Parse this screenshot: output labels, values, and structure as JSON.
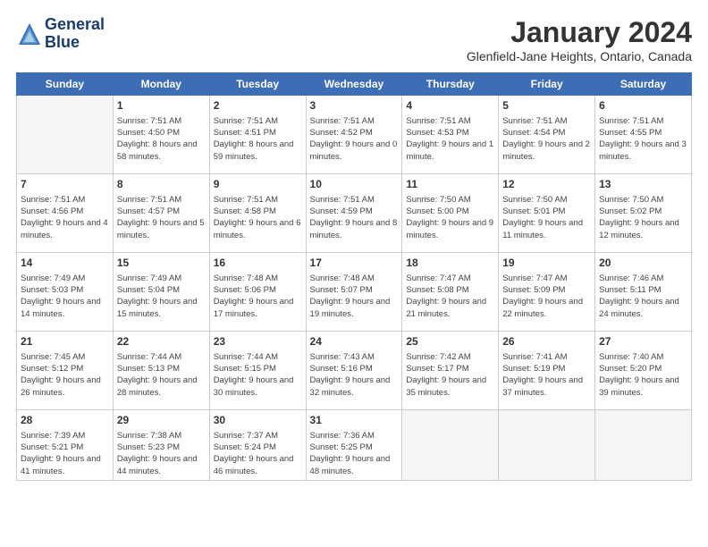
{
  "header": {
    "logo_line1": "General",
    "logo_line2": "Blue",
    "month": "January 2024",
    "location": "Glenfield-Jane Heights, Ontario, Canada"
  },
  "weekdays": [
    "Sunday",
    "Monday",
    "Tuesday",
    "Wednesday",
    "Thursday",
    "Friday",
    "Saturday"
  ],
  "weeks": [
    [
      {
        "day": "",
        "sunrise": "",
        "sunset": "",
        "daylight": ""
      },
      {
        "day": "1",
        "sunrise": "Sunrise: 7:51 AM",
        "sunset": "Sunset: 4:50 PM",
        "daylight": "Daylight: 8 hours and 58 minutes."
      },
      {
        "day": "2",
        "sunrise": "Sunrise: 7:51 AM",
        "sunset": "Sunset: 4:51 PM",
        "daylight": "Daylight: 8 hours and 59 minutes."
      },
      {
        "day": "3",
        "sunrise": "Sunrise: 7:51 AM",
        "sunset": "Sunset: 4:52 PM",
        "daylight": "Daylight: 9 hours and 0 minutes."
      },
      {
        "day": "4",
        "sunrise": "Sunrise: 7:51 AM",
        "sunset": "Sunset: 4:53 PM",
        "daylight": "Daylight: 9 hours and 1 minute."
      },
      {
        "day": "5",
        "sunrise": "Sunrise: 7:51 AM",
        "sunset": "Sunset: 4:54 PM",
        "daylight": "Daylight: 9 hours and 2 minutes."
      },
      {
        "day": "6",
        "sunrise": "Sunrise: 7:51 AM",
        "sunset": "Sunset: 4:55 PM",
        "daylight": "Daylight: 9 hours and 3 minutes."
      }
    ],
    [
      {
        "day": "7",
        "sunrise": "Sunrise: 7:51 AM",
        "sunset": "Sunset: 4:56 PM",
        "daylight": "Daylight: 9 hours and 4 minutes."
      },
      {
        "day": "8",
        "sunrise": "Sunrise: 7:51 AM",
        "sunset": "Sunset: 4:57 PM",
        "daylight": "Daylight: 9 hours and 5 minutes."
      },
      {
        "day": "9",
        "sunrise": "Sunrise: 7:51 AM",
        "sunset": "Sunset: 4:58 PM",
        "daylight": "Daylight: 9 hours and 6 minutes."
      },
      {
        "day": "10",
        "sunrise": "Sunrise: 7:51 AM",
        "sunset": "Sunset: 4:59 PM",
        "daylight": "Daylight: 9 hours and 8 minutes."
      },
      {
        "day": "11",
        "sunrise": "Sunrise: 7:50 AM",
        "sunset": "Sunset: 5:00 PM",
        "daylight": "Daylight: 9 hours and 9 minutes."
      },
      {
        "day": "12",
        "sunrise": "Sunrise: 7:50 AM",
        "sunset": "Sunset: 5:01 PM",
        "daylight": "Daylight: 9 hours and 11 minutes."
      },
      {
        "day": "13",
        "sunrise": "Sunrise: 7:50 AM",
        "sunset": "Sunset: 5:02 PM",
        "daylight": "Daylight: 9 hours and 12 minutes."
      }
    ],
    [
      {
        "day": "14",
        "sunrise": "Sunrise: 7:49 AM",
        "sunset": "Sunset: 5:03 PM",
        "daylight": "Daylight: 9 hours and 14 minutes."
      },
      {
        "day": "15",
        "sunrise": "Sunrise: 7:49 AM",
        "sunset": "Sunset: 5:04 PM",
        "daylight": "Daylight: 9 hours and 15 minutes."
      },
      {
        "day": "16",
        "sunrise": "Sunrise: 7:48 AM",
        "sunset": "Sunset: 5:06 PM",
        "daylight": "Daylight: 9 hours and 17 minutes."
      },
      {
        "day": "17",
        "sunrise": "Sunrise: 7:48 AM",
        "sunset": "Sunset: 5:07 PM",
        "daylight": "Daylight: 9 hours and 19 minutes."
      },
      {
        "day": "18",
        "sunrise": "Sunrise: 7:47 AM",
        "sunset": "Sunset: 5:08 PM",
        "daylight": "Daylight: 9 hours and 21 minutes."
      },
      {
        "day": "19",
        "sunrise": "Sunrise: 7:47 AM",
        "sunset": "Sunset: 5:09 PM",
        "daylight": "Daylight: 9 hours and 22 minutes."
      },
      {
        "day": "20",
        "sunrise": "Sunrise: 7:46 AM",
        "sunset": "Sunset: 5:11 PM",
        "daylight": "Daylight: 9 hours and 24 minutes."
      }
    ],
    [
      {
        "day": "21",
        "sunrise": "Sunrise: 7:45 AM",
        "sunset": "Sunset: 5:12 PM",
        "daylight": "Daylight: 9 hours and 26 minutes."
      },
      {
        "day": "22",
        "sunrise": "Sunrise: 7:44 AM",
        "sunset": "Sunset: 5:13 PM",
        "daylight": "Daylight: 9 hours and 28 minutes."
      },
      {
        "day": "23",
        "sunrise": "Sunrise: 7:44 AM",
        "sunset": "Sunset: 5:15 PM",
        "daylight": "Daylight: 9 hours and 30 minutes."
      },
      {
        "day": "24",
        "sunrise": "Sunrise: 7:43 AM",
        "sunset": "Sunset: 5:16 PM",
        "daylight": "Daylight: 9 hours and 32 minutes."
      },
      {
        "day": "25",
        "sunrise": "Sunrise: 7:42 AM",
        "sunset": "Sunset: 5:17 PM",
        "daylight": "Daylight: 9 hours and 35 minutes."
      },
      {
        "day": "26",
        "sunrise": "Sunrise: 7:41 AM",
        "sunset": "Sunset: 5:19 PM",
        "daylight": "Daylight: 9 hours and 37 minutes."
      },
      {
        "day": "27",
        "sunrise": "Sunrise: 7:40 AM",
        "sunset": "Sunset: 5:20 PM",
        "daylight": "Daylight: 9 hours and 39 minutes."
      }
    ],
    [
      {
        "day": "28",
        "sunrise": "Sunrise: 7:39 AM",
        "sunset": "Sunset: 5:21 PM",
        "daylight": "Daylight: 9 hours and 41 minutes."
      },
      {
        "day": "29",
        "sunrise": "Sunrise: 7:38 AM",
        "sunset": "Sunset: 5:23 PM",
        "daylight": "Daylight: 9 hours and 44 minutes."
      },
      {
        "day": "30",
        "sunrise": "Sunrise: 7:37 AM",
        "sunset": "Sunset: 5:24 PM",
        "daylight": "Daylight: 9 hours and 46 minutes."
      },
      {
        "day": "31",
        "sunrise": "Sunrise: 7:36 AM",
        "sunset": "Sunset: 5:25 PM",
        "daylight": "Daylight: 9 hours and 48 minutes."
      },
      {
        "day": "",
        "sunrise": "",
        "sunset": "",
        "daylight": ""
      },
      {
        "day": "",
        "sunrise": "",
        "sunset": "",
        "daylight": ""
      },
      {
        "day": "",
        "sunrise": "",
        "sunset": "",
        "daylight": ""
      }
    ]
  ]
}
